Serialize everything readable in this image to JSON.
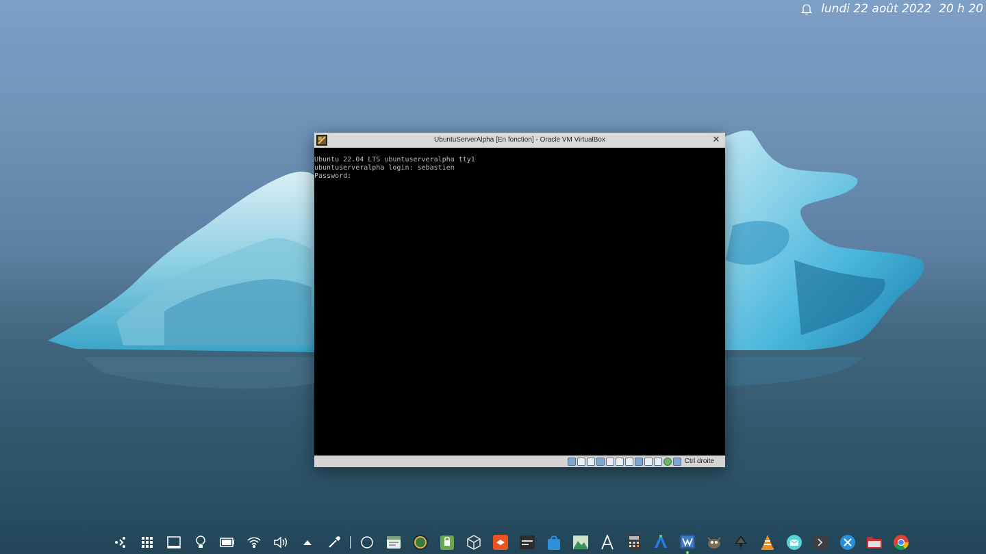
{
  "topbar": {
    "notification_icon": "bell-icon",
    "clock_text": "lundi 22 août 2022  20 h 20"
  },
  "vbox_window": {
    "title": "UbuntuServerAlpha [En fonction] - Oracle VM VirtualBox",
    "close_glyph": "✕",
    "terminal_lines": [
      "Ubuntu 22.04 LTS ubuntuserveralpha tty1",
      "",
      "ubuntuserveralpha login: sebastien",
      "Password:"
    ],
    "status_icons": [
      "hard-disk-icon",
      "optical-drive-icon",
      "audio-icon",
      "network-icon",
      "usb-icon",
      "shared-folders-icon",
      "display-icon",
      "recording-icon",
      "video-capture-icon",
      "cpu-icon",
      "globe-icon",
      "mouse-integration-icon"
    ],
    "host_key_label": "Ctrl droite"
  },
  "dock": {
    "items": [
      "connect-icon",
      "apps-grid-icon",
      "show-desktop-icon",
      "bulb-icon",
      "battery-icon",
      "wifi-icon",
      "volume-icon",
      "tray-expand-icon",
      "color-picker-icon",
      "circle-icon",
      "file-manager-icon",
      "globe-app-icon",
      "password-manager-icon",
      "virtualbox-icon",
      "software-center-icon",
      "terminal-app-icon",
      "store-icon",
      "image-viewer-icon",
      "font-icon",
      "calculator-icon",
      "vscode-icon",
      "virtualbox-vm-icon",
      "gimp-icon",
      "inkscape-icon",
      "vlc-icon",
      "mail-icon",
      "console-icon",
      "kde-connect-icon",
      "folder-icon",
      "chrome-icon"
    ]
  },
  "colors": {
    "terminal_text": "#bdbdbd",
    "window_chrome": "#d9d9d9"
  }
}
